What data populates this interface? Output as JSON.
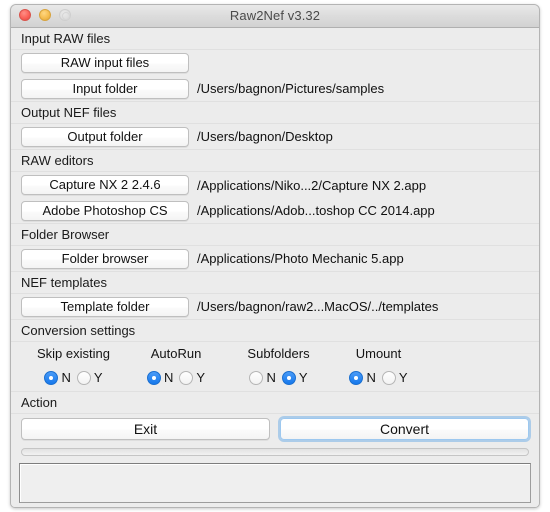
{
  "window": {
    "title": "Raw2Nef v3.32",
    "traffic_lights": [
      {
        "name": "close-button",
        "color": "#fb6158",
        "enabled": true
      },
      {
        "name": "minimize-button",
        "color": "#f5bd4f",
        "enabled": true
      },
      {
        "name": "zoom-button",
        "color": "#dedede",
        "enabled": false
      }
    ]
  },
  "sections": {
    "input_raw": {
      "header": "Input RAW files",
      "raw_input_files_button": "RAW input files",
      "raw_input_files_path": "",
      "input_folder_button": "Input folder",
      "input_folder_path": "/Users/bagnon/Pictures/samples"
    },
    "output_nef": {
      "header": "Output NEF files",
      "output_folder_button": "Output folder",
      "output_folder_path": "/Users/bagnon/Desktop"
    },
    "raw_editors": {
      "header": "RAW editors",
      "editor1_button": "Capture NX 2 2.4.6",
      "editor1_path": "/Applications/Niko...2/Capture NX 2.app",
      "editor2_button": "Adobe Photoshop CS",
      "editor2_path": "/Applications/Adob...toshop CC 2014.app"
    },
    "folder_browser": {
      "header": "Folder Browser",
      "folder_browser_button": "Folder browser",
      "folder_browser_path": "/Applications/Photo Mechanic 5.app"
    },
    "nef_templates": {
      "header": "NEF templates",
      "template_folder_button": "Template folder",
      "template_folder_path": "/Users/bagnon/raw2...MacOS/../templates"
    },
    "conversion_settings": {
      "header": "Conversion settings",
      "options": [
        {
          "label": "Skip existing",
          "no_label": "N",
          "yes_label": "Y",
          "value": "N"
        },
        {
          "label": "AutoRun",
          "no_label": "N",
          "yes_label": "Y",
          "value": "N"
        },
        {
          "label": "Subfolders",
          "no_label": "N",
          "yes_label": "Y",
          "value": "Y"
        },
        {
          "label": "Umount",
          "no_label": "N",
          "yes_label": "Y",
          "value": "N"
        }
      ]
    },
    "action": {
      "header": "Action",
      "exit_button": "Exit",
      "convert_button": "Convert",
      "convert_focused": true
    }
  },
  "progress": {
    "value": 0,
    "max": 100
  },
  "log": {
    "text": "",
    "placeholder": ""
  },
  "colors": {
    "accent": "#1678ec",
    "window_bg": "#ececec",
    "focus_ring": "#9dc8ef"
  }
}
